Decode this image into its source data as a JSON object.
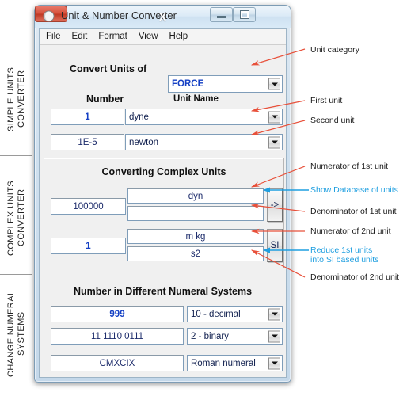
{
  "window": {
    "title": "Unit & Number Converter",
    "icon": "app-circle-icon",
    "buttons": {
      "minimize": "minimize-icon",
      "maximize": "maximize-icon",
      "close": "X"
    }
  },
  "menubar": {
    "items": [
      {
        "pre": "",
        "key": "F",
        "post": "ile"
      },
      {
        "pre": "",
        "key": "E",
        "post": "dit"
      },
      {
        "pre": "F",
        "key": "o",
        "post": "rmat"
      },
      {
        "pre": "",
        "key": "V",
        "post": "iew"
      },
      {
        "pre": "",
        "key": "H",
        "post": "elp"
      }
    ]
  },
  "simple_units": {
    "convert_label": "Convert Units of",
    "category": "FORCE",
    "col_number": "Number",
    "col_unit_name": "Unit Name",
    "rows": [
      {
        "number": "1",
        "unit": "dyne"
      },
      {
        "number": "1E-5",
        "unit": "newton"
      }
    ]
  },
  "complex_units": {
    "title": "Converting Complex Units",
    "first": {
      "number": "100000",
      "numerator": "dyn",
      "denominator": "",
      "button": "->"
    },
    "second": {
      "number": "1",
      "numerator": "m kg",
      "denominator": "s2",
      "button": "SI"
    }
  },
  "numeral_systems": {
    "title": "Number in Different Numeral Systems",
    "rows": [
      {
        "value": "999",
        "system": "10 - decimal",
        "highlight": true
      },
      {
        "value": "11 1110 0111",
        "system": "2 - binary",
        "highlight": false
      },
      {
        "value": "CMXCIX",
        "system": "Roman numeral",
        "highlight": false
      }
    ]
  },
  "side_sections": [
    "SIMPLE UNITS\nCONVERTER",
    "COMPLEX UNITS\nCONVERTER",
    "CHANGE NUMERAL\nSYSTEMS"
  ],
  "annotations": [
    {
      "text": "Unit category",
      "color": "#1b1b1b"
    },
    {
      "text": "First unit",
      "color": "#1b1b1b"
    },
    {
      "text": "Second unit",
      "color": "#1b1b1b"
    },
    {
      "text": "Numerator of 1st unit",
      "color": "#1b1b1b"
    },
    {
      "text": "Show Database of units",
      "color": "#1f9fe0"
    },
    {
      "text": "Denominator of 1st unit",
      "color": "#1b1b1b"
    },
    {
      "text": "Numerator of 2nd unit",
      "color": "#1b1b1b"
    },
    {
      "text": "Reduce 1st units",
      "color": "#1f9fe0"
    },
    {
      "text": "into SI based units",
      "color": "#1f9fe0"
    },
    {
      "text": "Denominator of 2nd unit",
      "color": "#1b1b1b"
    }
  ],
  "colors": {
    "annotation_red": "#e8503a",
    "annotation_blue": "#1f9fe0",
    "value_blue": "#1540c4",
    "title_close": "#bf3722"
  }
}
